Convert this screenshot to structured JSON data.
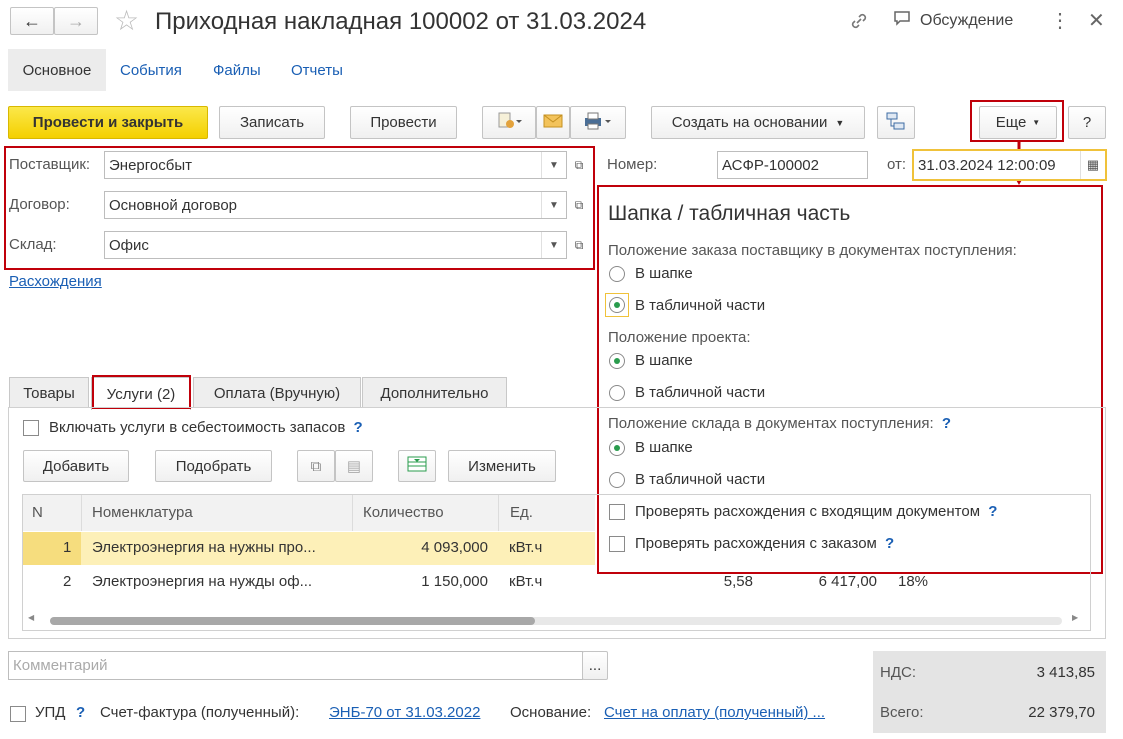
{
  "window": {
    "title": "Приходная накладная 100002 от 31.03.2024",
    "discussion_label": "Обсуждение"
  },
  "nav_tabs": [
    "Основное",
    "События",
    "Файлы",
    "Отчеты"
  ],
  "toolbar": {
    "post_close": "Провести и закрыть",
    "save": "Записать",
    "post": "Провести",
    "create_based": "Создать на основании",
    "more": "Еще",
    "help": "?"
  },
  "header": {
    "supplier_label": "Поставщик:",
    "supplier_value": "Энергосбыт",
    "contract_label": "Договор:",
    "contract_value": "Основной договор",
    "warehouse_label": "Склад:",
    "warehouse_value": "Офис",
    "discrepancy_link": "Расхождения",
    "number_label": "Номер:",
    "number_value": "АСФР-100002",
    "date_label": "от:",
    "date_value": "31.03.2024 12:00:09"
  },
  "popup": {
    "title": "Шапка / табличная часть",
    "group1_label": "Положение заказа поставщику в документах поступления:",
    "group1_opt1": "В шапке",
    "group1_opt2": "В табличной части",
    "group2_label": "Положение проекта:",
    "group2_opt1": "В шапке",
    "group2_opt2": "В табличной части",
    "group3_label": "Положение склада в документах поступления:",
    "group3_opt1": "В шапке",
    "group3_opt2": "В табличной части",
    "check1": "Проверять расхождения с входящим документом",
    "check2": "Проверять расхождения с заказом",
    "help": "?"
  },
  "tabs": [
    "Товары",
    "Услуги (2)",
    "Оплата (Вручную)",
    "Дополнительно"
  ],
  "services": {
    "include_cost_label": "Включать услуги в себестоимость запасов",
    "help": "?",
    "add": "Добавить",
    "pick": "Подобрать",
    "change": "Изменить",
    "columns": [
      "N",
      "Номенклатура",
      "Количество",
      "Ед."
    ],
    "rows": [
      {
        "n": "1",
        "name": "Электроэнергия на нужны про...",
        "qty": "4 093,000",
        "unit": "кВт.ч",
        "price": "",
        "sum": "",
        "vat": ""
      },
      {
        "n": "2",
        "name": "Электроэнергия на нужды оф...",
        "qty": "1 150,000",
        "unit": "кВт.ч",
        "price": "5,58",
        "sum": "6 417,00",
        "vat": "18%"
      }
    ]
  },
  "footer": {
    "comment_placeholder": "Комментарий",
    "comment_btn": "...",
    "upd_label": "УПД",
    "upd_help": "?",
    "invoice_label": "Счет-фактура (полученный):",
    "invoice_link": "ЭНБ-70 от 31.03.2022",
    "basis_label": "Основание:",
    "basis_link": "Счет на оплату (полученный) ...",
    "vat_label": "НДС:",
    "vat_value": "3 413,85",
    "total_label": "Всего:",
    "total_value": "22 379,70"
  },
  "colors": {
    "accent_yellow": "#f4d000",
    "highlight_red": "#c0000a",
    "link_blue": "#1a5fb4",
    "radio_green": "#2a9c4d",
    "selected_row": "#fdf0b8"
  }
}
